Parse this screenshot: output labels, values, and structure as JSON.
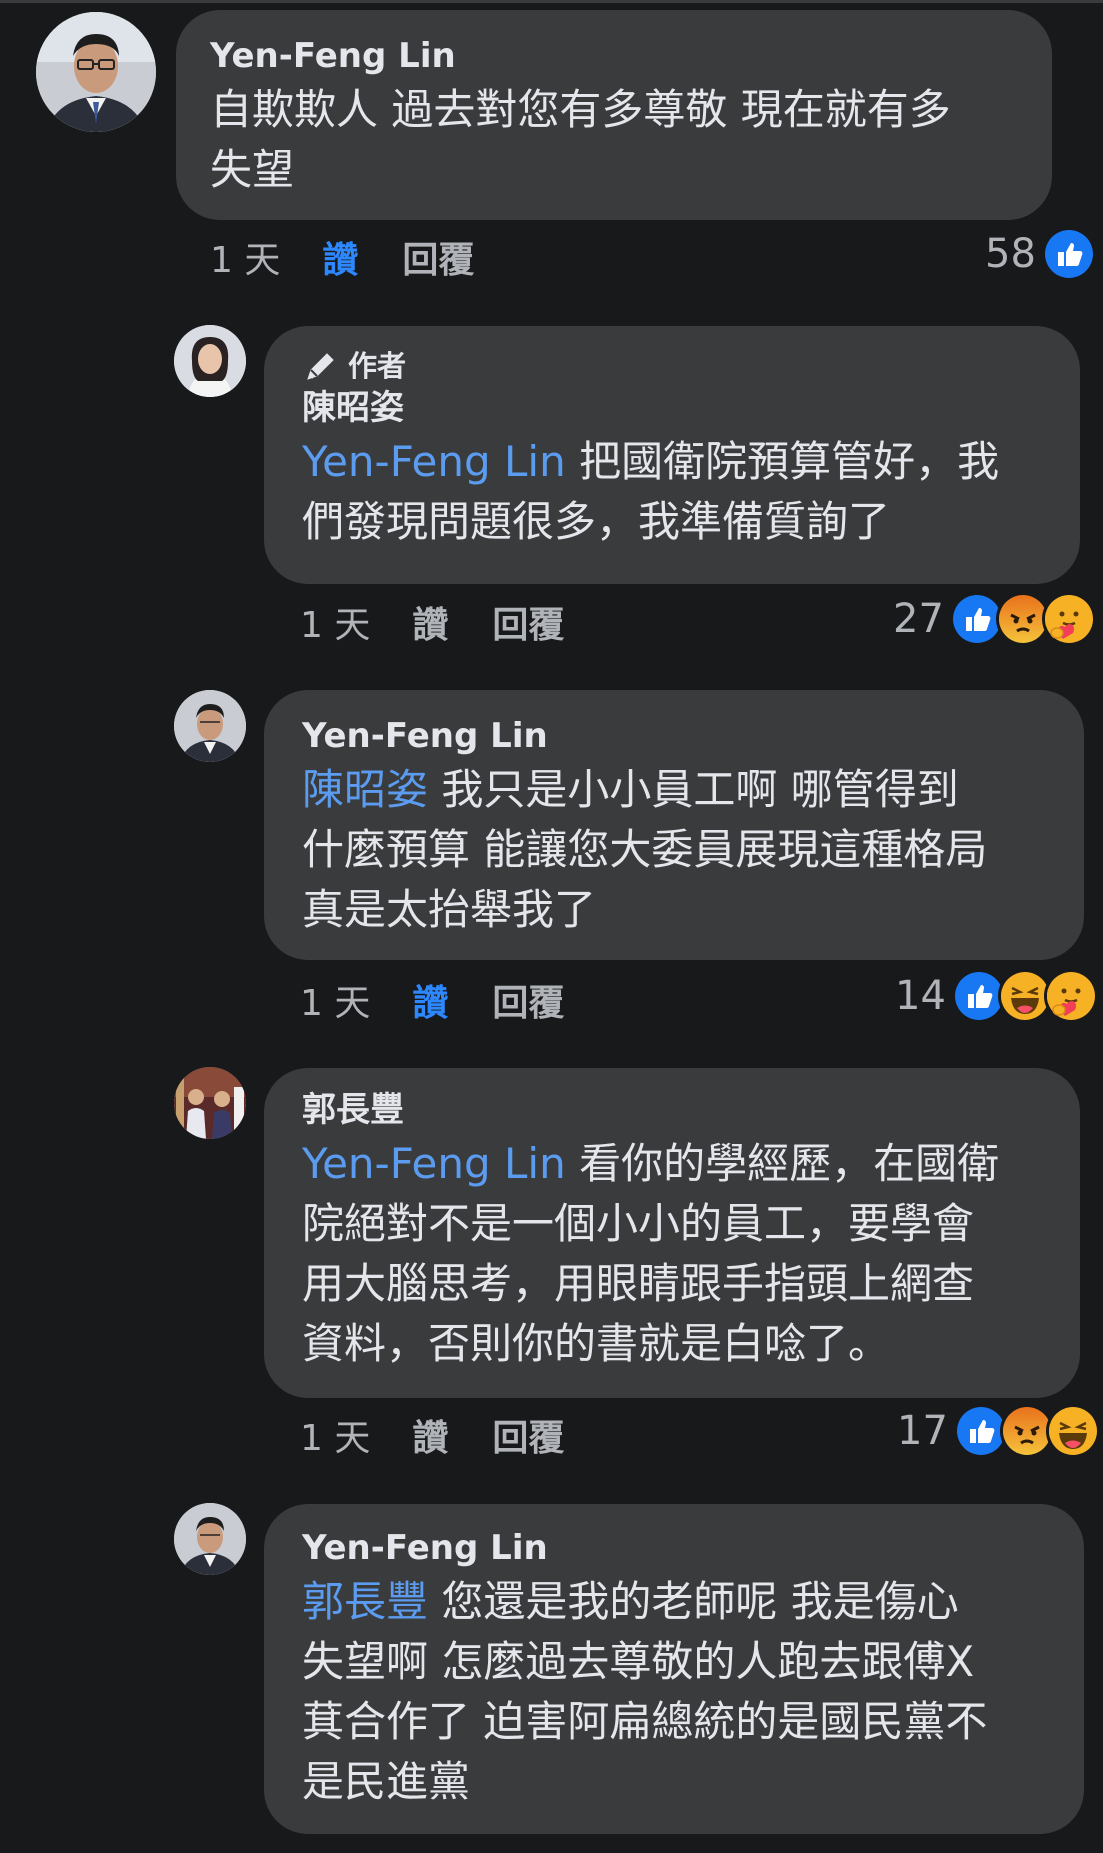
{
  "comments": [
    {
      "author": "Yen-Feng Lin",
      "lines": [
        "自欺欺人 過去對您有多尊敬 現在就有多",
        "失望"
      ],
      "time": "1 天",
      "like": "讚",
      "reply": "回覆",
      "like_active": true,
      "reaction_count": "58",
      "reactions": [
        "like-icon"
      ]
    },
    {
      "badge": "作者",
      "author": "陳昭姿",
      "mention": "Yen-Feng Lin",
      "line1_rest": " 把國衛院預算管好，我",
      "lines_more": [
        "們發現問題很多，我準備質詢了"
      ],
      "time": "1 天",
      "like": "讚",
      "reply": "回覆",
      "like_active": false,
      "reaction_count": "27",
      "reactions": [
        "like-icon",
        "angry-icon",
        "care-icon"
      ]
    },
    {
      "author": "Yen-Feng Lin",
      "mention": "陳昭姿",
      "line1_rest": " 我只是小小員工啊 哪管得到",
      "lines_more": [
        "什麼預算 能讓您大委員展現這種格局",
        "真是太抬舉我了"
      ],
      "time": "1 天",
      "like": "讚",
      "reply": "回覆",
      "like_active": true,
      "reaction_count": "14",
      "reactions": [
        "like-icon",
        "haha-icon",
        "care-icon"
      ]
    },
    {
      "author": "郭長豐",
      "mention": "Yen-Feng Lin",
      "line1_rest": " 看你的學經歷，在國衛",
      "lines_more": [
        "院絕對不是一個小小的員工，要學會",
        "用大腦思考，用眼睛跟手指頭上網查",
        "資料，否則你的書就是白唸了。"
      ],
      "time": "1 天",
      "like": "讚",
      "reply": "回覆",
      "like_active": false,
      "reaction_count": "17",
      "reactions": [
        "like-icon",
        "angry-icon",
        "haha-icon"
      ]
    },
    {
      "author": "Yen-Feng Lin",
      "mention": "郭長豐",
      "line1_rest": " 您還是我的老師呢 我是傷心",
      "lines_more": [
        "失望啊 怎麼過去尊敬的人跑去跟傅X",
        "萁合作了 迫害阿扁總統的是國民黨不",
        "是民進黨"
      ]
    }
  ],
  "colors": {
    "background": "#18191a",
    "bubble": "#3a3b3c",
    "mention": "#5b9cf0",
    "like_active": "#2d88ff",
    "meta": "#b0b3b8"
  }
}
